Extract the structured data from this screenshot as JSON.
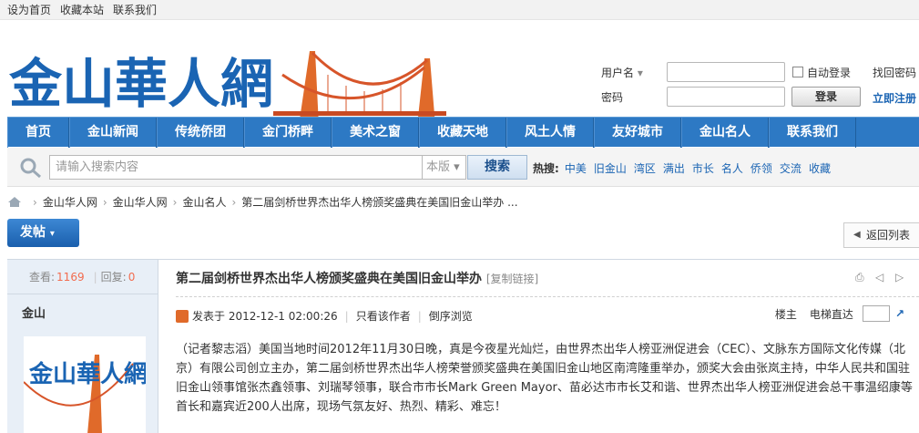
{
  "topbar": {
    "links": [
      "设为首页",
      "收藏本站",
      "联系我们"
    ]
  },
  "logo": {
    "text": "金山華人網"
  },
  "login": {
    "username_label": "用户名",
    "password_label": "密码",
    "remember_label": "自动登录",
    "submit_label": "登录",
    "forgot_label": "找回密码",
    "register_label": "立即注册"
  },
  "nav": {
    "items": [
      "首页",
      "金山新闻",
      "传统侨团",
      "金门桥畔",
      "美术之窗",
      "收藏天地",
      "风土人情",
      "友好城市",
      "金山名人",
      "联系我们"
    ]
  },
  "search": {
    "placeholder": "请输入搜索内容",
    "scope": "本版",
    "button": "搜索",
    "hot_label": "热搜:",
    "hot_terms": [
      "中美",
      "旧金山",
      "湾区",
      "满出",
      "市长",
      "名人",
      "侨领",
      "交流",
      "收藏"
    ]
  },
  "breadcrumb": [
    "金山华人网",
    "金山华人网",
    "金山名人",
    "第二届剑桥世界杰出华人榜颁奖盛典在美国旧金山举办 ..."
  ],
  "actions": {
    "post_label": "发帖",
    "back_label": "返回列表"
  },
  "thread": {
    "views_label": "查看:",
    "views": "1169",
    "replies_label": "回复:",
    "replies": "0",
    "author": "金山",
    "title": "第二届剑桥世界杰出华人榜颁奖盛典在美国旧金山举办",
    "copy_link": "[复制链接]",
    "posted": "发表于 2012-12-1 02:00:26",
    "only_author": "只看该作者",
    "reverse": "倒序浏览",
    "floor": "楼主",
    "jump": "电梯直达",
    "body": "（记者黎志滔）美国当地时间2012年11月30日晚，真是今夜星光灿烂，由世界杰出华人榜亚洲促进会（CEC）、文脉东方国际文化传媒（北京）有限公司创立主办，第二届剑桥世界杰出华人榜荣誉颁奖盛典在美国旧金山地区南湾隆重举办，颁奖大会由张岚主持，中华人民共和国驻旧金山领事馆张杰鑫领事、刘瑞琴领事，联合市市长Mark Green Mayor、苗必达市市长艾和谐、世界杰出华人榜亚洲促进会总干事温绍康等首长和嘉宾近200人出席，现场气氛友好、热烈、精彩、难忘！"
  },
  "colors": {
    "nav": "#2d79c4",
    "logo_text": "#1a64b3",
    "bridge": "#e06a2a",
    "views": "#f26c4f"
  }
}
